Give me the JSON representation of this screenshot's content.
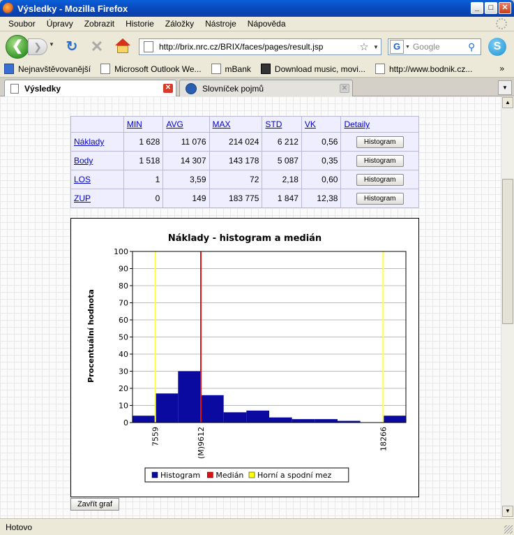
{
  "window": {
    "title": "Výsledky - Mozilla Firefox",
    "btn_minimize": "_",
    "btn_maximize": "□",
    "btn_close": "✕"
  },
  "menu": [
    "Soubor",
    "Úpravy",
    "Zobrazit",
    "Historie",
    "Záložky",
    "Nástroje",
    "Nápověda"
  ],
  "nav": {
    "url": "http://brix.nrc.cz/BRIX/faces/pages/result.jsp",
    "search_placeholder": "Google",
    "search_engine_letter": "G"
  },
  "bookmarks": {
    "items": [
      "Nejnavštěvovanější",
      "Microsoft Outlook We...",
      "mBank",
      "Download music, movi...",
      "http://www.bodnik.cz..."
    ],
    "more": "»"
  },
  "tabs": [
    {
      "label": "Výsledky",
      "active": true
    },
    {
      "label": "Slovníček pojmů",
      "active": false
    }
  ],
  "stats_table": {
    "headers": [
      "MIN",
      "AVG",
      "MAX",
      "STD",
      "VK",
      "Detaily"
    ],
    "rows": [
      {
        "name": "Náklady",
        "min": "1 628",
        "avg": "11 076",
        "max": "214 024",
        "std": "6 212",
        "vk": "0,56",
        "btn": "Histogram"
      },
      {
        "name": "Body",
        "min": "1 518",
        "avg": "14 307",
        "max": "143 178",
        "std": "5 087",
        "vk": "0,35",
        "btn": "Histogram"
      },
      {
        "name": "LOS",
        "min": "1",
        "avg": "3,59",
        "max": "72",
        "std": "2,18",
        "vk": "0,60",
        "btn": "Histogram"
      },
      {
        "name": "ZUP",
        "min": "0",
        "avg": "149",
        "max": "183 775",
        "std": "1 847",
        "vk": "12,38",
        "btn": "Histogram"
      }
    ]
  },
  "chart_data": {
    "type": "bar",
    "title": "Náklady - histogram a medián",
    "ylabel": "Procentuální hodnota",
    "ylim": [
      0,
      100
    ],
    "yticks": [
      0,
      10,
      20,
      30,
      40,
      50,
      60,
      70,
      80,
      90,
      100
    ],
    "bins": 12,
    "values": [
      4,
      17,
      30,
      16,
      6,
      7,
      3,
      2,
      2,
      1,
      0,
      4
    ],
    "grid": true,
    "vlines": [
      {
        "label": "7559",
        "bin_position": 1.0,
        "color": "#ffff44",
        "series": "Horní a spodní mez"
      },
      {
        "label": "(M)9612",
        "bin_position": 3.0,
        "color": "#dd1111",
        "series": "Medián"
      },
      {
        "label": "18266",
        "bin_position": 11.0,
        "color": "#ffff44",
        "series": "Horní a spodní mez"
      }
    ],
    "legend": [
      {
        "name": "Histogram",
        "color": "#0a0aa0"
      },
      {
        "name": "Medián",
        "color": "#dd1111"
      },
      {
        "name": "Horní a spodní mez",
        "color": "#ffff00"
      }
    ],
    "legend_position": "bottom",
    "bar_color": "#0a0aa0"
  },
  "close_chart_label": "Zavřít graf",
  "status": "Hotovo"
}
